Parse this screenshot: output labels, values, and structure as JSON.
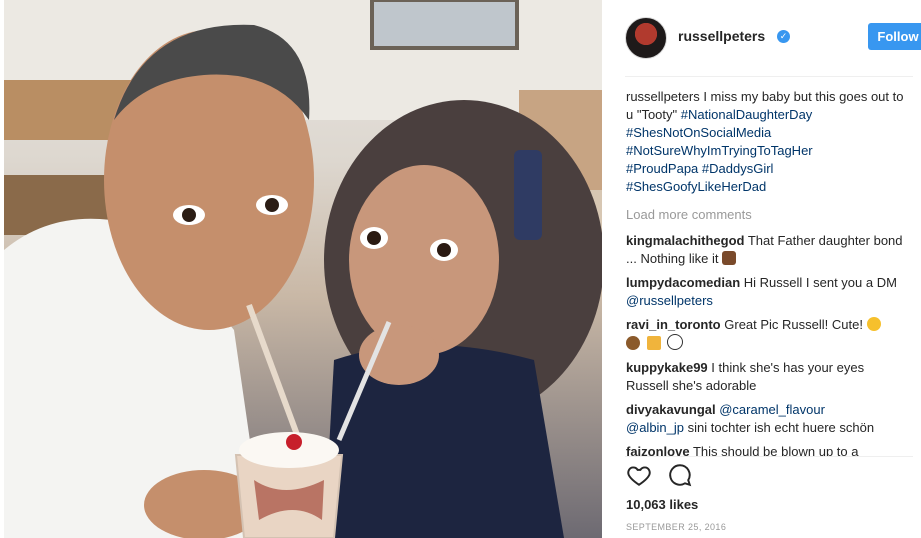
{
  "post": {
    "username": "russellpeters",
    "verified_symbol": "✓",
    "follow_label": "Follow",
    "caption_user": "russellpeters",
    "caption_text": "I miss my baby but this goes out to u \"Tooty\"",
    "hashtags": [
      "#NationalDaughterDay",
      "#ShesNotOnSocialMedia",
      "#NotSureWhyImTryingToTagHer",
      "#ProudPapa",
      "#DaddysGirl",
      "#ShesGoofyLikeHerDad"
    ],
    "load_more": "Load more comments",
    "comments": [
      {
        "user": "kingmalachithegod",
        "text": "That Father daughter bond ... Nothing like it",
        "mention": "",
        "tail": ""
      },
      {
        "user": "lumpydacomedian",
        "text": "Hi Russell I sent you a DM",
        "mention": "@russellpeters",
        "tail": ""
      },
      {
        "user": "ravi_in_toronto",
        "text": "Great Pic Russell! Cute!",
        "mention": "",
        "tail": ""
      },
      {
        "user": "kuppykake99",
        "text": "I think she's has your eyes Russell she's adorable",
        "mention": "",
        "tail": ""
      },
      {
        "user": "divyakavungal",
        "text": "",
        "mention": "@caramel_flavour",
        "tail": "sini tochter ish echt huere schön",
        "mention2": "@albin_jp"
      },
      {
        "user": "faizonlove",
        "text": "This should be blown up to a",
        "mention": "",
        "tail": ""
      }
    ],
    "likes": "10,063 likes",
    "date": "SEPTEMBER 25, 2016"
  },
  "colors": {
    "accent": "#3897f0",
    "hashtag": "#003569",
    "muted": "#999999"
  },
  "icons": {
    "like": "heart-icon",
    "comment": "comment-icon",
    "verified": "verified-badge-icon"
  }
}
